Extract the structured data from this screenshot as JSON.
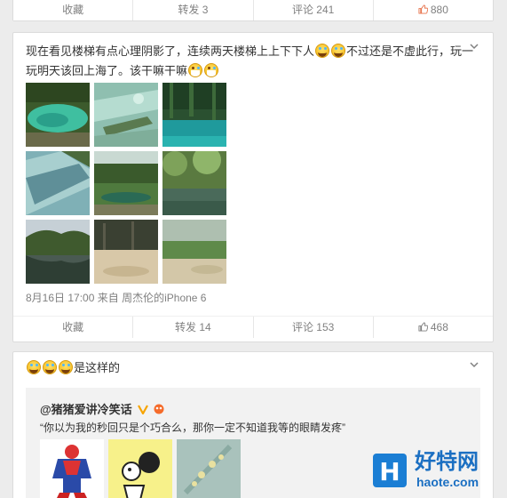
{
  "post1": {
    "actions": [
      {
        "label": "收藏"
      },
      {
        "label": "转发 3"
      },
      {
        "label": "评论 241"
      },
      {
        "label": "880"
      }
    ]
  },
  "post2": {
    "text_part1": "现在看见楼梯有点心理阴影了，连续两天楼梯上上下下人",
    "text_part2": "不过还是不虚此行，玩一玩明天该回上海了。该干嘛干嘛",
    "time": "8月16日 17:00",
    "from_prefix": "来自",
    "source": "周杰伦的iPhone 6",
    "actions": [
      {
        "label": "收藏"
      },
      {
        "label": "转发 14"
      },
      {
        "label": "评论 153"
      },
      {
        "label": "468"
      }
    ]
  },
  "post3": {
    "text": "是这样的",
    "repost": {
      "user": "@猪猪爱讲冷笑话",
      "text": "“你以为我的秒回只是个巧合么，那你一定不知道我等的眼睛发疼”"
    }
  },
  "watermark": {
    "logo_letter": "H",
    "cn": "好特网",
    "domain": "haote.com"
  },
  "icon_names": [
    "thumbs-up-icon",
    "chevron-down-icon",
    "laugh-emoji-icon",
    "grin-emoji-icon",
    "verified-v-icon"
  ]
}
